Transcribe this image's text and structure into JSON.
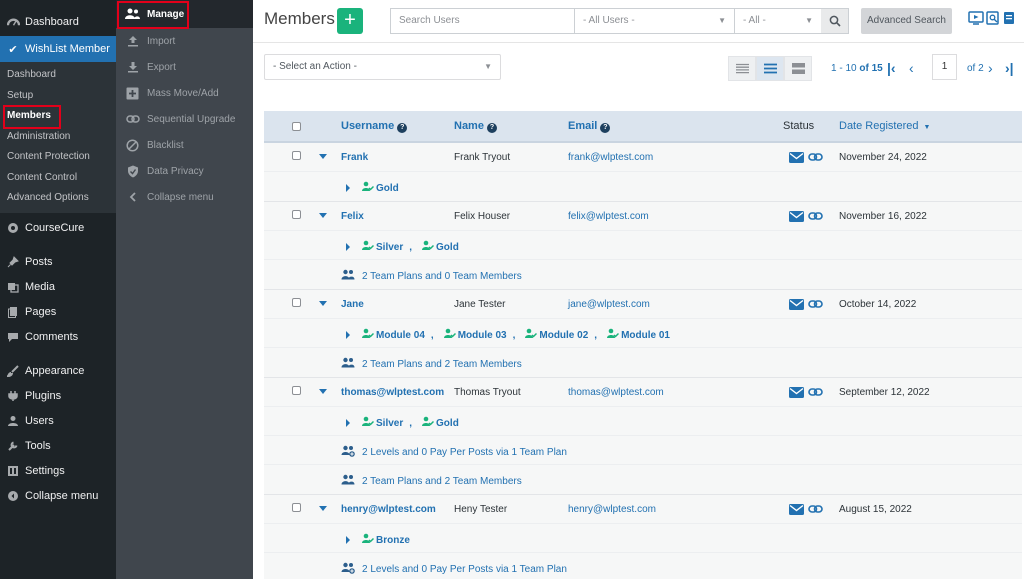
{
  "wp_menu": {
    "dashboard": "Dashboard",
    "wishlist": "WishList Member",
    "submenu": [
      "Dashboard",
      "Setup",
      "Members",
      "Administration",
      "Content Protection",
      "Content Control",
      "Advanced Options"
    ],
    "items": [
      "CourseCure",
      "Posts",
      "Media",
      "Pages",
      "Comments",
      "Appearance",
      "Plugins",
      "Users",
      "Tools",
      "Settings",
      "Collapse menu"
    ],
    "icons": [
      "graduation-icon",
      "pin-icon",
      "media-icon",
      "pages-icon",
      "comments-icon",
      "brush-icon",
      "plug-icon",
      "user-icon",
      "wrench-icon",
      "settings-icon",
      "collapse-icon"
    ]
  },
  "wl_menu": {
    "items": [
      "Manage",
      "Import",
      "Export",
      "Mass Move/Add",
      "Sequential Upgrade",
      "Blacklist",
      "Data Privacy",
      "Collapse menu"
    ],
    "icons": [
      "users-icon",
      "upload-icon",
      "download-icon",
      "plus-square-icon",
      "link-icon",
      "blocked-icon",
      "shield-icon",
      "chevron-left-icon"
    ]
  },
  "header": {
    "title": "Members",
    "add_symbol": "+",
    "search_placeholder": "Search Users",
    "filter_users": "- All Users -",
    "filter_all": "- All -",
    "advanced_search": "Advanced Search"
  },
  "toolbar": {
    "action_select": "- Select an Action -",
    "range": "1 - 10",
    "of_total": " of 15",
    "page": "1",
    "of_pages": "of 2"
  },
  "columns": {
    "username": "Username",
    "name": "Name",
    "email": "Email",
    "status": "Status",
    "date": "Date Registered"
  },
  "members": [
    {
      "username": "Frank",
      "name": "Frank Tryout",
      "email": "frank@wlptest.com",
      "date": "November 24, 2022",
      "levels": [
        "Gold"
      ],
      "info": []
    },
    {
      "username": "Felix",
      "name": "Felix Houser",
      "email": "felix@wlptest.com",
      "date": "November 16, 2022",
      "levels": [
        "Silver",
        "Gold"
      ],
      "info": [
        {
          "icon": "team-icon",
          "text": "2 Team Plans and 0 Team Members"
        }
      ]
    },
    {
      "username": "Jane",
      "name": "Jane Tester",
      "email": "jane@wlptest.com",
      "date": "October 14, 2022",
      "levels": [
        "Module 04",
        "Module 03",
        "Module 02",
        "Module 01"
      ],
      "info": [
        {
          "icon": "team-icon",
          "text": "2 Team Plans and 2 Team Members"
        }
      ]
    },
    {
      "username": "thomas@wlptest.com",
      "name": "Thomas Tryout",
      "email": "thomas@wlptest.com",
      "date": "September 12, 2022",
      "levels": [
        "Silver",
        "Gold"
      ],
      "info": [
        {
          "icon": "team-plan-icon",
          "text": "2 Levels and 0 Pay Per Posts via 1 Team Plan"
        },
        {
          "icon": "team-icon",
          "text": "2 Team Plans and 2 Team Members"
        }
      ]
    },
    {
      "username": "henry@wlptest.com",
      "name": "Heny Tester",
      "email": "henry@wlptest.com",
      "date": "August 15, 2022",
      "levels": [
        "Bronze"
      ],
      "info": [
        {
          "icon": "team-plan-icon",
          "text": "2 Levels and 0 Pay Per Posts via 1 Team Plan"
        }
      ]
    }
  ],
  "colors": {
    "accent": "#2271b1",
    "add": "#1ab37c",
    "highlight": "#e2001a"
  }
}
